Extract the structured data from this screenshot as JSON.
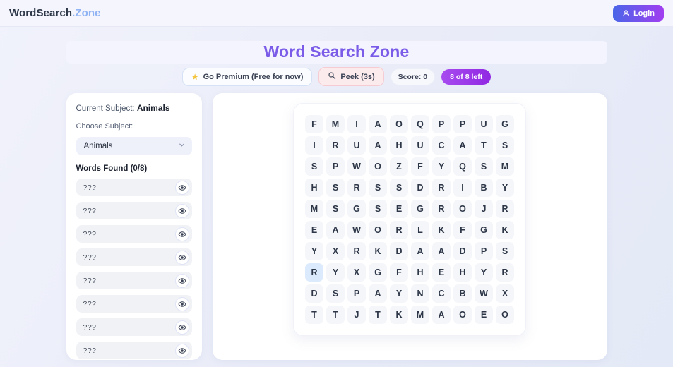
{
  "header": {
    "logo_primary": "WordSearch",
    "logo_accent": ".Zone",
    "login_label": "Login",
    "login_icon": "person-icon"
  },
  "title": "Word Search Zone",
  "toolbar": {
    "premium_label": "Go Premium (Free for now)",
    "premium_icon": "star-icon",
    "peek_label": "Peek (3s)",
    "peek_icon": "magnifier-icon",
    "score_label": "Score: 0",
    "remaining_label": "8 of 8 left"
  },
  "sidebar": {
    "current_subject_label": "Current Subject:",
    "current_subject_value": "Animals",
    "choose_subject_label": "Choose Subject:",
    "subject_selected": "Animals",
    "subject_dropdown_icon": "chevron-down-icon",
    "words_found_label": "Words Found (0/8)",
    "hidden_word_placeholder": "???",
    "word_count": 8,
    "reveal_icon": "eye-icon"
  },
  "grid": {
    "rows": [
      [
        "F",
        "M",
        "I",
        "A",
        "O",
        "Q",
        "P",
        "P",
        "U",
        "G"
      ],
      [
        "I",
        "R",
        "U",
        "A",
        "H",
        "U",
        "C",
        "A",
        "T",
        "S"
      ],
      [
        "S",
        "P",
        "W",
        "O",
        "Z",
        "F",
        "Y",
        "Q",
        "S",
        "M"
      ],
      [
        "H",
        "S",
        "R",
        "S",
        "S",
        "D",
        "R",
        "I",
        "B",
        "Y"
      ],
      [
        "M",
        "S",
        "G",
        "S",
        "E",
        "G",
        "R",
        "O",
        "J",
        "R"
      ],
      [
        "E",
        "A",
        "W",
        "O",
        "R",
        "L",
        "K",
        "F",
        "G",
        "K"
      ],
      [
        "Y",
        "X",
        "R",
        "K",
        "D",
        "A",
        "A",
        "D",
        "P",
        "S"
      ],
      [
        "R",
        "Y",
        "X",
        "G",
        "F",
        "H",
        "E",
        "H",
        "Y",
        "R"
      ],
      [
        "D",
        "S",
        "P",
        "A",
        "Y",
        "N",
        "C",
        "B",
        "W",
        "X"
      ],
      [
        "T",
        "T",
        "J",
        "T",
        "K",
        "M",
        "A",
        "O",
        "E",
        "O"
      ]
    ],
    "highlighted_cell": {
      "row": 7,
      "col": 0
    }
  },
  "colors": {
    "accent_purple": "#7a5ce8",
    "logo_blue": "#4d73e6",
    "logo_light_blue": "#90b3f4",
    "remaining_badge_purple": "#9128e3",
    "peek_pink": "#fcebed",
    "highlight_blue": "#dceafd",
    "cell_gray": "#f5f6f9"
  }
}
